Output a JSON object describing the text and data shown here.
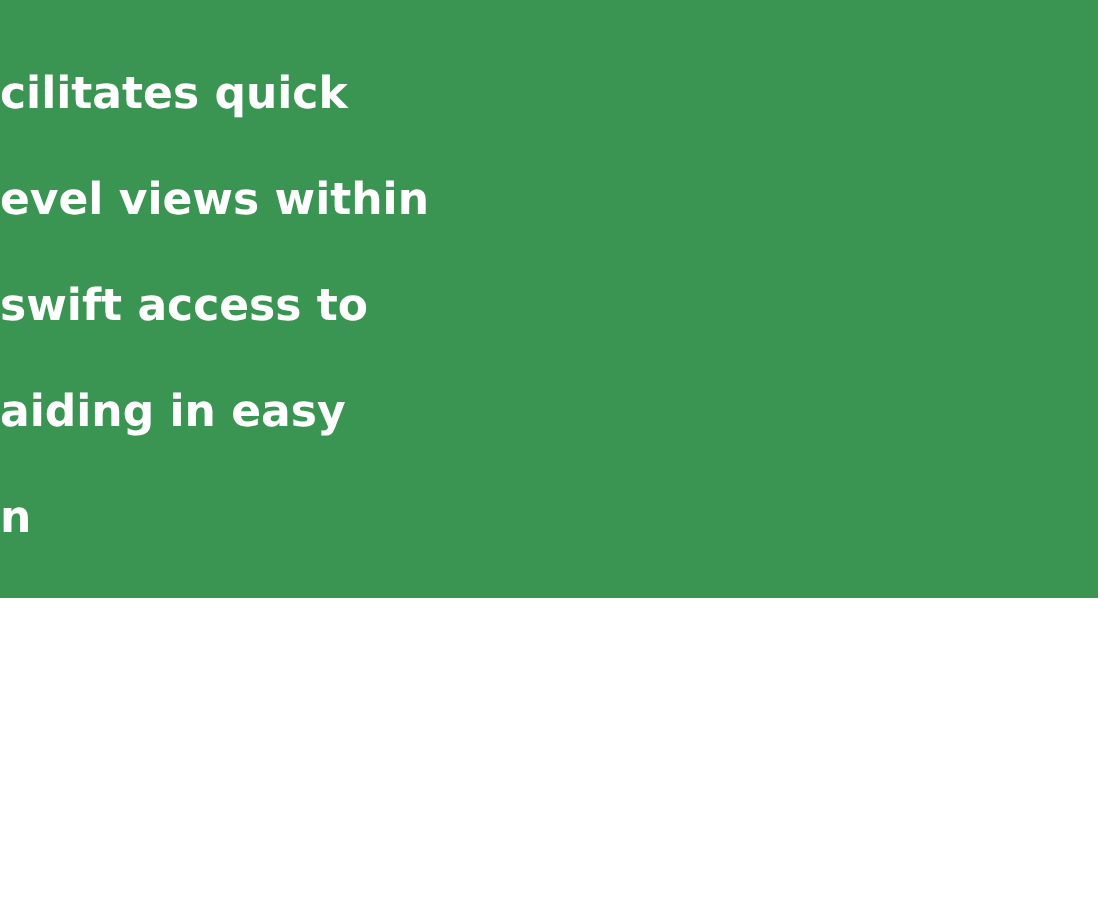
{
  "banner": {
    "lines": [
      "cilitates quick",
      "evel views within",
      "swift access to",
      "aiding in easy",
      "n"
    ]
  }
}
